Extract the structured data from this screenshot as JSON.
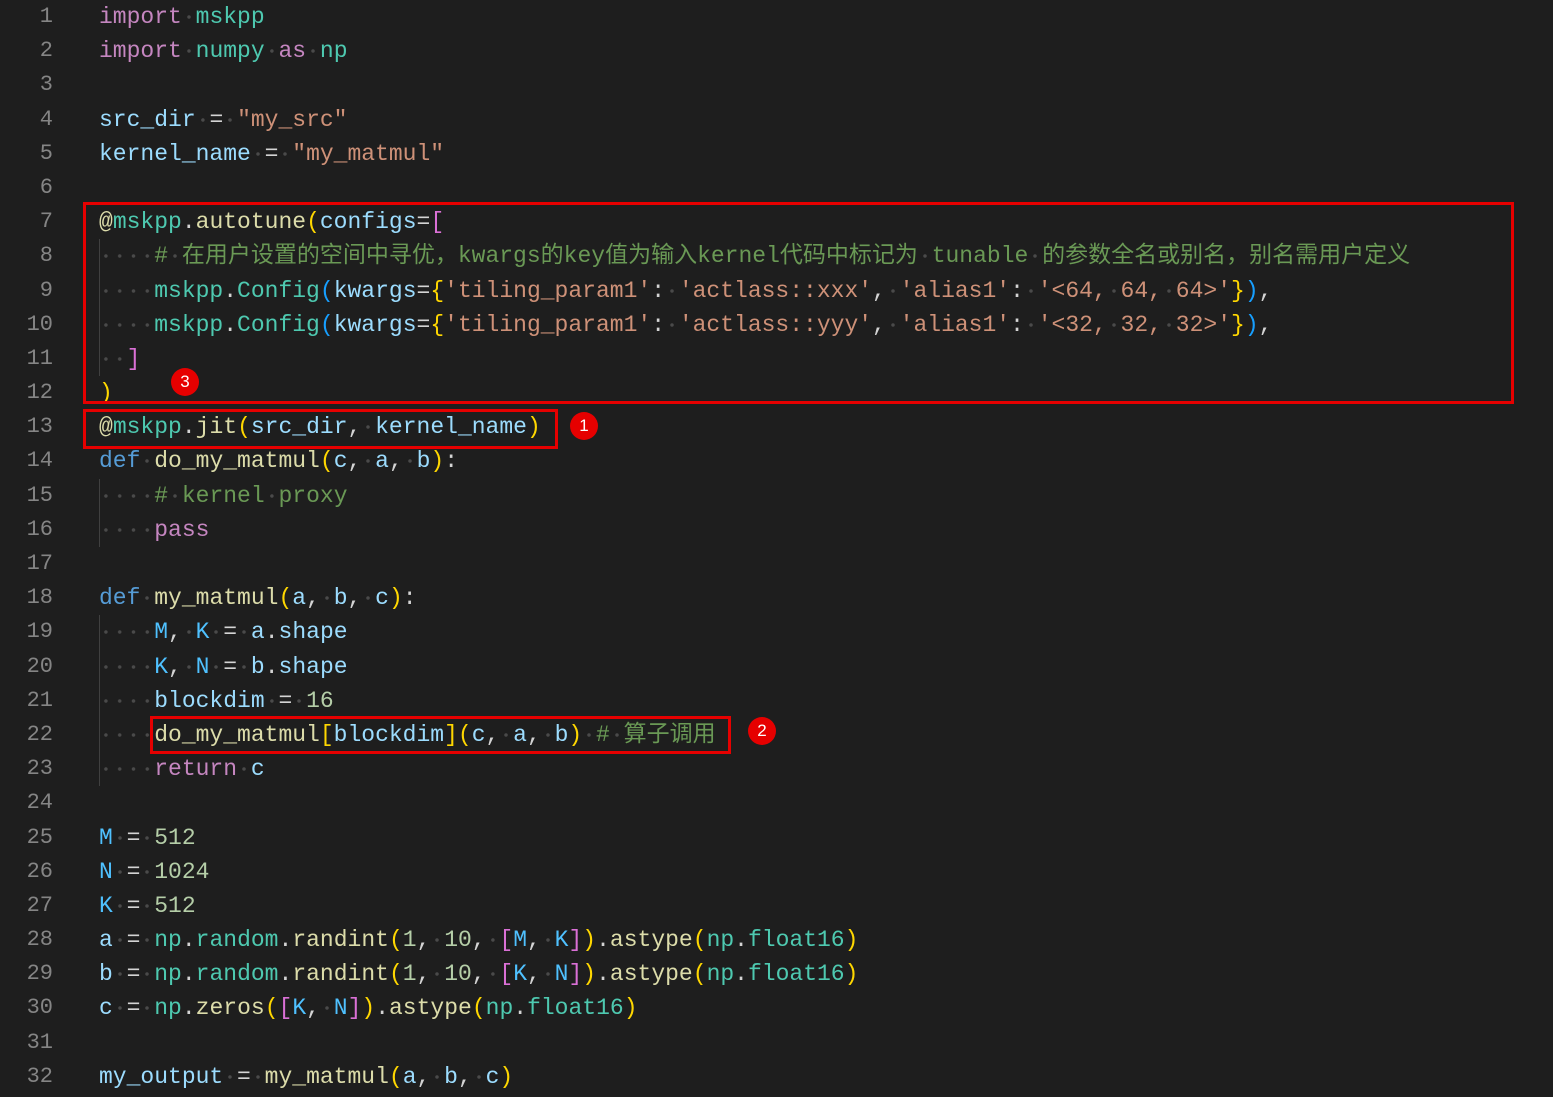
{
  "theme": {
    "background": "#1e1e1e",
    "line_number": "#858585",
    "indent_guide": "#404040",
    "whitespace": "#4a4a4a",
    "annotation": "#e60000",
    "annotation_text": "#ffffff"
  },
  "editor": {
    "lines": [
      {
        "num": "1",
        "tokens": [
          [
            "import ",
            "#c586c0"
          ],
          [
            "mskpp",
            "#4ec9b0"
          ]
        ]
      },
      {
        "num": "2",
        "tokens": [
          [
            "import ",
            "#c586c0"
          ],
          [
            "numpy ",
            "#4ec9b0"
          ],
          [
            "as ",
            "#c586c0"
          ],
          [
            "np",
            "#4ec9b0"
          ]
        ]
      },
      {
        "num": "3",
        "tokens": []
      },
      {
        "num": "4",
        "tokens": [
          [
            "src_dir ",
            "#9cdcfe"
          ],
          [
            "= ",
            "#d4d4d4"
          ],
          [
            "\"my_src\"",
            "#ce9178"
          ]
        ]
      },
      {
        "num": "5",
        "tokens": [
          [
            "kernel_name ",
            "#9cdcfe"
          ],
          [
            "= ",
            "#d4d4d4"
          ],
          [
            "\"my_matmul\"",
            "#ce9178"
          ]
        ]
      },
      {
        "num": "6",
        "tokens": []
      },
      {
        "num": "7",
        "tokens": [
          [
            "@",
            "#dcdcaa"
          ],
          [
            "mskpp",
            "#4ec9b0"
          ],
          [
            ".",
            "#d4d4d4"
          ],
          [
            "autotune",
            "#dcdcaa"
          ],
          [
            "(",
            "#ffd700"
          ],
          [
            "configs",
            "#9cdcfe"
          ],
          [
            "=",
            "#d4d4d4"
          ],
          [
            "[",
            "#da70d6"
          ]
        ]
      },
      {
        "num": "8",
        "tokens": [
          [
            "    ",
            "#d4d4d4"
          ],
          [
            "# 在用户设置的空间中寻优，kwargs的key值为输入kernel代码中标记为 tunable 的参数全名或别名，别名需用户定义",
            "#6a9955"
          ]
        ]
      },
      {
        "num": "9",
        "tokens": [
          [
            "    ",
            "#d4d4d4"
          ],
          [
            "mskpp",
            "#4ec9b0"
          ],
          [
            ".",
            "#d4d4d4"
          ],
          [
            "Config",
            "#4ec9b0"
          ],
          [
            "(",
            "#179fff"
          ],
          [
            "kwargs",
            "#9cdcfe"
          ],
          [
            "=",
            "#d4d4d4"
          ],
          [
            "{",
            "#ffd700"
          ],
          [
            "'tiling_param1'",
            "#ce9178"
          ],
          [
            ": ",
            "#d4d4d4"
          ],
          [
            "'actlass::xxx'",
            "#ce9178"
          ],
          [
            ", ",
            "#d4d4d4"
          ],
          [
            "'alias1'",
            "#ce9178"
          ],
          [
            ": ",
            "#d4d4d4"
          ],
          [
            "'<64, 64, 64>'",
            "#ce9178"
          ],
          [
            "}",
            "#ffd700"
          ],
          [
            ")",
            "#179fff"
          ],
          [
            ",",
            "#d4d4d4"
          ]
        ]
      },
      {
        "num": "10",
        "tokens": [
          [
            "    ",
            "#d4d4d4"
          ],
          [
            "mskpp",
            "#4ec9b0"
          ],
          [
            ".",
            "#d4d4d4"
          ],
          [
            "Config",
            "#4ec9b0"
          ],
          [
            "(",
            "#179fff"
          ],
          [
            "kwargs",
            "#9cdcfe"
          ],
          [
            "=",
            "#d4d4d4"
          ],
          [
            "{",
            "#ffd700"
          ],
          [
            "'tiling_param1'",
            "#ce9178"
          ],
          [
            ": ",
            "#d4d4d4"
          ],
          [
            "'actlass::yyy'",
            "#ce9178"
          ],
          [
            ", ",
            "#d4d4d4"
          ],
          [
            "'alias1'",
            "#ce9178"
          ],
          [
            ": ",
            "#d4d4d4"
          ],
          [
            "'<32, 32, 32>'",
            "#ce9178"
          ],
          [
            "}",
            "#ffd700"
          ],
          [
            ")",
            "#179fff"
          ],
          [
            ",",
            "#d4d4d4"
          ]
        ]
      },
      {
        "num": "11",
        "tokens": [
          [
            "  ",
            "#d4d4d4"
          ],
          [
            "]",
            "#da70d6"
          ]
        ]
      },
      {
        "num": "12",
        "tokens": [
          [
            ")",
            "#ffd700"
          ]
        ]
      },
      {
        "num": "13",
        "tokens": [
          [
            "@",
            "#dcdcaa"
          ],
          [
            "mskpp",
            "#4ec9b0"
          ],
          [
            ".",
            "#d4d4d4"
          ],
          [
            "jit",
            "#dcdcaa"
          ],
          [
            "(",
            "#ffd700"
          ],
          [
            "src_dir",
            "#9cdcfe"
          ],
          [
            ", ",
            "#d4d4d4"
          ],
          [
            "kernel_name",
            "#9cdcfe"
          ],
          [
            ")",
            "#ffd700"
          ]
        ]
      },
      {
        "num": "14",
        "tokens": [
          [
            "def ",
            "#569cd6"
          ],
          [
            "do_my_matmul",
            "#dcdcaa"
          ],
          [
            "(",
            "#ffd700"
          ],
          [
            "c",
            "#9cdcfe"
          ],
          [
            ", ",
            "#d4d4d4"
          ],
          [
            "a",
            "#9cdcfe"
          ],
          [
            ", ",
            "#d4d4d4"
          ],
          [
            "b",
            "#9cdcfe"
          ],
          [
            ")",
            "#ffd700"
          ],
          [
            ":",
            "#d4d4d4"
          ]
        ]
      },
      {
        "num": "15",
        "tokens": [
          [
            "    ",
            "#d4d4d4"
          ],
          [
            "# kernel proxy",
            "#6a9955"
          ]
        ]
      },
      {
        "num": "16",
        "tokens": [
          [
            "    ",
            "#d4d4d4"
          ],
          [
            "pass",
            "#c586c0"
          ]
        ]
      },
      {
        "num": "17",
        "tokens": []
      },
      {
        "num": "18",
        "tokens": [
          [
            "def ",
            "#569cd6"
          ],
          [
            "my_matmul",
            "#dcdcaa"
          ],
          [
            "(",
            "#ffd700"
          ],
          [
            "a",
            "#9cdcfe"
          ],
          [
            ", ",
            "#d4d4d4"
          ],
          [
            "b",
            "#9cdcfe"
          ],
          [
            ", ",
            "#d4d4d4"
          ],
          [
            "c",
            "#9cdcfe"
          ],
          [
            ")",
            "#ffd700"
          ],
          [
            ":",
            "#d4d4d4"
          ]
        ]
      },
      {
        "num": "19",
        "tokens": [
          [
            "    ",
            "#d4d4d4"
          ],
          [
            "M",
            "#4fc1ff"
          ],
          [
            ", ",
            "#d4d4d4"
          ],
          [
            "K ",
            "#4fc1ff"
          ],
          [
            "= ",
            "#d4d4d4"
          ],
          [
            "a",
            "#9cdcfe"
          ],
          [
            ".",
            "#d4d4d4"
          ],
          [
            "shape",
            "#9cdcfe"
          ]
        ]
      },
      {
        "num": "20",
        "tokens": [
          [
            "    ",
            "#d4d4d4"
          ],
          [
            "K",
            "#4fc1ff"
          ],
          [
            ", ",
            "#d4d4d4"
          ],
          [
            "N ",
            "#4fc1ff"
          ],
          [
            "= ",
            "#d4d4d4"
          ],
          [
            "b",
            "#9cdcfe"
          ],
          [
            ".",
            "#d4d4d4"
          ],
          [
            "shape",
            "#9cdcfe"
          ]
        ]
      },
      {
        "num": "21",
        "tokens": [
          [
            "    ",
            "#d4d4d4"
          ],
          [
            "blockdim ",
            "#9cdcfe"
          ],
          [
            "= ",
            "#d4d4d4"
          ],
          [
            "16",
            "#b5cea8"
          ]
        ]
      },
      {
        "num": "22",
        "tokens": [
          [
            "    ",
            "#d4d4d4"
          ],
          [
            "do_my_matmul",
            "#dcdcaa"
          ],
          [
            "[",
            "#ffd700"
          ],
          [
            "blockdim",
            "#9cdcfe"
          ],
          [
            "]",
            "#ffd700"
          ],
          [
            "(",
            "#ffd700"
          ],
          [
            "c",
            "#9cdcfe"
          ],
          [
            ", ",
            "#d4d4d4"
          ],
          [
            "a",
            "#9cdcfe"
          ],
          [
            ", ",
            "#d4d4d4"
          ],
          [
            "b",
            "#9cdcfe"
          ],
          [
            ") ",
            "#ffd700"
          ],
          [
            "# 算子调用",
            "#6a9955"
          ]
        ]
      },
      {
        "num": "23",
        "tokens": [
          [
            "    ",
            "#d4d4d4"
          ],
          [
            "return ",
            "#c586c0"
          ],
          [
            "c",
            "#9cdcfe"
          ]
        ]
      },
      {
        "num": "24",
        "tokens": []
      },
      {
        "num": "25",
        "tokens": [
          [
            "M ",
            "#4fc1ff"
          ],
          [
            "= ",
            "#d4d4d4"
          ],
          [
            "512",
            "#b5cea8"
          ]
        ]
      },
      {
        "num": "26",
        "tokens": [
          [
            "N ",
            "#4fc1ff"
          ],
          [
            "= ",
            "#d4d4d4"
          ],
          [
            "1024",
            "#b5cea8"
          ]
        ]
      },
      {
        "num": "27",
        "tokens": [
          [
            "K ",
            "#4fc1ff"
          ],
          [
            "= ",
            "#d4d4d4"
          ],
          [
            "512",
            "#b5cea8"
          ]
        ]
      },
      {
        "num": "28",
        "tokens": [
          [
            "a ",
            "#9cdcfe"
          ],
          [
            "= ",
            "#d4d4d4"
          ],
          [
            "np",
            "#4ec9b0"
          ],
          [
            ".",
            "#d4d4d4"
          ],
          [
            "random",
            "#4ec9b0"
          ],
          [
            ".",
            "#d4d4d4"
          ],
          [
            "randint",
            "#dcdcaa"
          ],
          [
            "(",
            "#ffd700"
          ],
          [
            "1",
            "#b5cea8"
          ],
          [
            ", ",
            "#d4d4d4"
          ],
          [
            "10",
            "#b5cea8"
          ],
          [
            ", ",
            "#d4d4d4"
          ],
          [
            "[",
            "#da70d6"
          ],
          [
            "M",
            "#4fc1ff"
          ],
          [
            ", ",
            "#d4d4d4"
          ],
          [
            "K",
            "#4fc1ff"
          ],
          [
            "]",
            "#da70d6"
          ],
          [
            ")",
            "#ffd700"
          ],
          [
            ".",
            "#d4d4d4"
          ],
          [
            "astype",
            "#dcdcaa"
          ],
          [
            "(",
            "#ffd700"
          ],
          [
            "np",
            "#4ec9b0"
          ],
          [
            ".",
            "#d4d4d4"
          ],
          [
            "float16",
            "#4ec9b0"
          ],
          [
            ")",
            "#ffd700"
          ]
        ]
      },
      {
        "num": "29",
        "tokens": [
          [
            "b ",
            "#9cdcfe"
          ],
          [
            "= ",
            "#d4d4d4"
          ],
          [
            "np",
            "#4ec9b0"
          ],
          [
            ".",
            "#d4d4d4"
          ],
          [
            "random",
            "#4ec9b0"
          ],
          [
            ".",
            "#d4d4d4"
          ],
          [
            "randint",
            "#dcdcaa"
          ],
          [
            "(",
            "#ffd700"
          ],
          [
            "1",
            "#b5cea8"
          ],
          [
            ", ",
            "#d4d4d4"
          ],
          [
            "10",
            "#b5cea8"
          ],
          [
            ", ",
            "#d4d4d4"
          ],
          [
            "[",
            "#da70d6"
          ],
          [
            "K",
            "#4fc1ff"
          ],
          [
            ", ",
            "#d4d4d4"
          ],
          [
            "N",
            "#4fc1ff"
          ],
          [
            "]",
            "#da70d6"
          ],
          [
            ")",
            "#ffd700"
          ],
          [
            ".",
            "#d4d4d4"
          ],
          [
            "astype",
            "#dcdcaa"
          ],
          [
            "(",
            "#ffd700"
          ],
          [
            "np",
            "#4ec9b0"
          ],
          [
            ".",
            "#d4d4d4"
          ],
          [
            "float16",
            "#4ec9b0"
          ],
          [
            ")",
            "#ffd700"
          ]
        ]
      },
      {
        "num": "30",
        "tokens": [
          [
            "c ",
            "#9cdcfe"
          ],
          [
            "= ",
            "#d4d4d4"
          ],
          [
            "np",
            "#4ec9b0"
          ],
          [
            ".",
            "#d4d4d4"
          ],
          [
            "zeros",
            "#dcdcaa"
          ],
          [
            "(",
            "#ffd700"
          ],
          [
            "[",
            "#da70d6"
          ],
          [
            "K",
            "#4fc1ff"
          ],
          [
            ", ",
            "#d4d4d4"
          ],
          [
            "N",
            "#4fc1ff"
          ],
          [
            "]",
            "#da70d6"
          ],
          [
            ")",
            "#ffd700"
          ],
          [
            ".",
            "#d4d4d4"
          ],
          [
            "astype",
            "#dcdcaa"
          ],
          [
            "(",
            "#ffd700"
          ],
          [
            "np",
            "#4ec9b0"
          ],
          [
            ".",
            "#d4d4d4"
          ],
          [
            "float16",
            "#4ec9b0"
          ],
          [
            ")",
            "#ffd700"
          ]
        ]
      },
      {
        "num": "31",
        "tokens": []
      },
      {
        "num": "32",
        "tokens": [
          [
            "my_output ",
            "#9cdcfe"
          ],
          [
            "= ",
            "#d4d4d4"
          ],
          [
            "my_matmul",
            "#dcdcaa"
          ],
          [
            "(",
            "#ffd700"
          ],
          [
            "a",
            "#9cdcfe"
          ],
          [
            ", ",
            "#d4d4d4"
          ],
          [
            "b",
            "#9cdcfe"
          ],
          [
            ", ",
            "#d4d4d4"
          ],
          [
            "c",
            "#9cdcfe"
          ],
          [
            ")",
            "#ffd700"
          ]
        ]
      }
    ]
  },
  "annotations": [
    {
      "label": "1"
    },
    {
      "label": "2"
    },
    {
      "label": "3"
    }
  ]
}
